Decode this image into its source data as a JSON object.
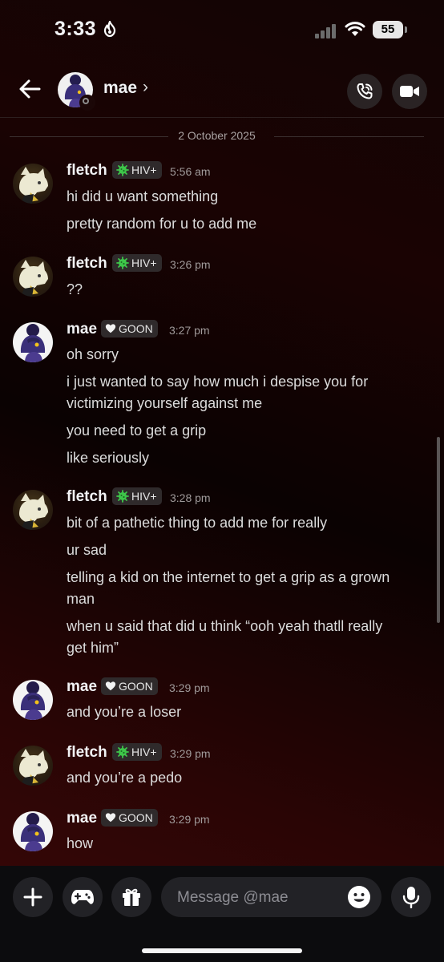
{
  "status_bar": {
    "time": "3:33",
    "battery": "55"
  },
  "header": {
    "contact_name": "mae",
    "chevron": "›",
    "icons": [
      "back-arrow-icon",
      "phone-call-icon",
      "video-call-icon"
    ]
  },
  "date_separator": "2 October 2025",
  "messages": [
    {
      "user": "fletch",
      "tag": "HIV+",
      "time": "5:56 am",
      "lines": [
        "hi did u want something",
        "pretty random for u to add me"
      ]
    },
    {
      "user": "fletch",
      "tag": "HIV+",
      "time": "3:26 pm",
      "lines": [
        "??"
      ]
    },
    {
      "user": "mae",
      "tag": "GOON",
      "time": "3:27 pm",
      "lines": [
        "oh sorry",
        "i just wanted to say how much i despise you for",
        "victimizing yourself against me",
        "you need to get a grip",
        "like seriously"
      ]
    },
    {
      "user": "fletch",
      "tag": "HIV+",
      "time": "3:28 pm",
      "lines": [
        "bit of a pathetic thing to add me for really",
        "ur sad",
        "telling a kid on the internet to get a grip as a grown",
        "man",
        "when u said that did u think “ooh yeah thatll really",
        "get him”"
      ]
    },
    {
      "user": "mae",
      "tag": "GOON",
      "time": "3:29 pm",
      "lines": [
        "and you’re a loser"
      ]
    },
    {
      "user": "fletch",
      "tag": "HIV+",
      "time": "3:29 pm",
      "lines": [
        "and you’re a pedo"
      ]
    },
    {
      "user": "mae",
      "tag": "GOON",
      "time": "3:29 pm",
      "lines": [
        "how"
      ]
    }
  ],
  "composer": {
    "placeholder": "Message @mae",
    "icons": [
      "plus-icon",
      "gamepad-icon",
      "gift-icon",
      "emoji-icon",
      "microphone-icon"
    ]
  },
  "colors": {
    "background": "#1a0303",
    "tag_bg": "#2f2a2b",
    "hiv_icon": "#3ec74a",
    "text": "#dcdcdc"
  }
}
